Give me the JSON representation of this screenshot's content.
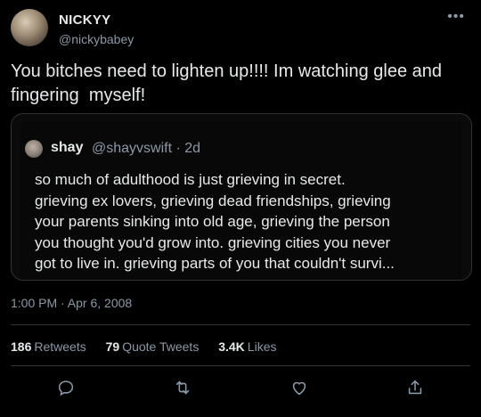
{
  "tweet": {
    "author_name": "NICKYY",
    "author_handle": "@nickybabey",
    "more_icon": "more-dots-icon",
    "text": "You bitches need to lighten up!!!! Im watching glee and\nfingering  myself!",
    "timestamp": "1:00 PM · Apr 6, 2008"
  },
  "quote": {
    "name": "shay",
    "handle_time": "@shayvswift · 2d",
    "text": "so much of adulthood is just grieving in secret.\ngrieving ex lovers, grieving dead friendships, grieving\nyour parents sinking into old age, grieving the person\nyou thought you'd grow into. grieving cities you never\ngot to live in. grieving parts of you that couldn't survi..."
  },
  "stats": {
    "retweets_count": "186",
    "retweets_label": "Retweets",
    "quote_count": "79",
    "quote_label": "Quote Tweets",
    "likes_count": "3.4K",
    "likes_label": "Likes"
  },
  "actions": [
    "reply-icon",
    "retweet-icon",
    "like-icon",
    "share-icon"
  ]
}
